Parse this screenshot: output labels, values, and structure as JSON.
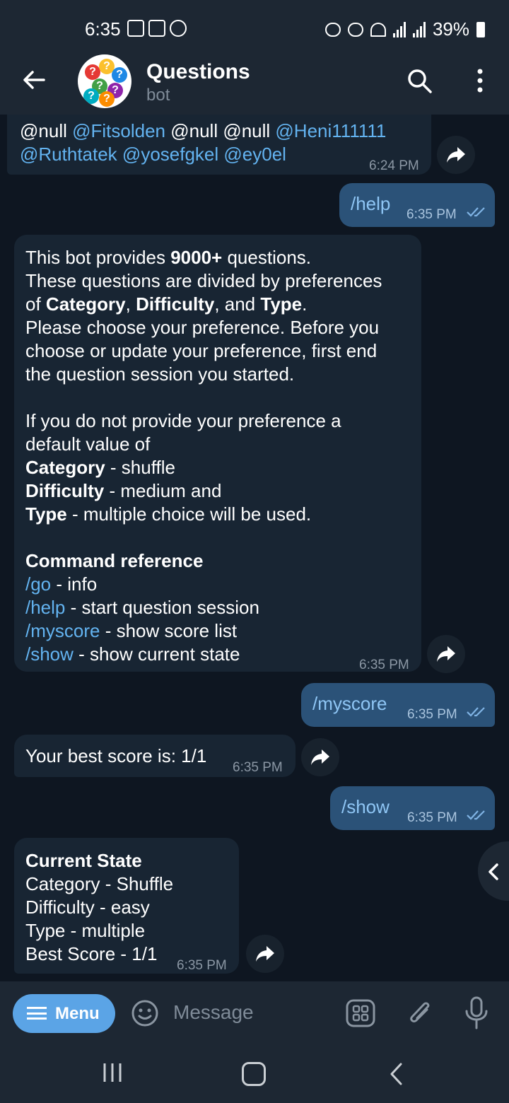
{
  "status": {
    "time": "6:35",
    "battery": "39%"
  },
  "header": {
    "title": "Questions",
    "subtitle": "bot"
  },
  "messages": {
    "m1": {
      "line1": [
        "@null ",
        "@Fitsolden",
        " @null @null ",
        "@Heni111111"
      ],
      "line2": [
        "@Ruthtatek",
        " ",
        "@yosefgkel",
        " ",
        "@ey0el"
      ],
      "time": "6:24 PM"
    },
    "m2": {
      "text": "/help",
      "time": "6:35 PM"
    },
    "m3": {
      "p1a": "This bot provides ",
      "p1b": "9000+",
      "p1c": " questions.",
      "p2": "These questions are divided by preferences",
      "p3a": "of ",
      "p3b": "Category",
      "p3c": ", ",
      "p3d": "Difficulty",
      "p3e": ", and ",
      "p3f": "Type",
      "p3g": ".",
      "p4": "Please choose your preference. Before you",
      "p5": "choose or update your preference, first end",
      "p6": "the question session you started.",
      "p7": "If you do not provide your preference a",
      "p8": "default value of",
      "c1k": "Category",
      "c1v": " - shuffle",
      "c2k": "Difficulty",
      "c2v": " - medium and",
      "c3k": "Type",
      "c3v": " - multiple choice will be used.",
      "ref": "Command reference",
      "cmd1k": "/go",
      "cmd1v": " - info",
      "cmd2k": "/help",
      "cmd2v": " - start question session",
      "cmd3k": "/myscore",
      "cmd3v": " - show score list",
      "cmd4k": "/show",
      "cmd4v": " - show current state",
      "time": "6:35 PM"
    },
    "m4": {
      "text": "/myscore",
      "time": "6:35 PM"
    },
    "m5": {
      "text": "Your best score is: 1/1",
      "time": "6:35 PM"
    },
    "m6": {
      "text": "/show",
      "time": "6:35 PM"
    },
    "m7": {
      "heading": "Current State",
      "l1": "Category - Shuffle",
      "l2": "Difficulty - easy",
      "l3": "Type - multiple",
      "l4": "Best Score - 1/1",
      "time": "6:35 PM"
    }
  },
  "input": {
    "menu_label": "Menu",
    "placeholder": "Message"
  },
  "colors": {
    "accent": "#5ba4e6",
    "link": "#63b3f0",
    "bubble_in": "#182533",
    "bubble_out": "#2b5278"
  }
}
